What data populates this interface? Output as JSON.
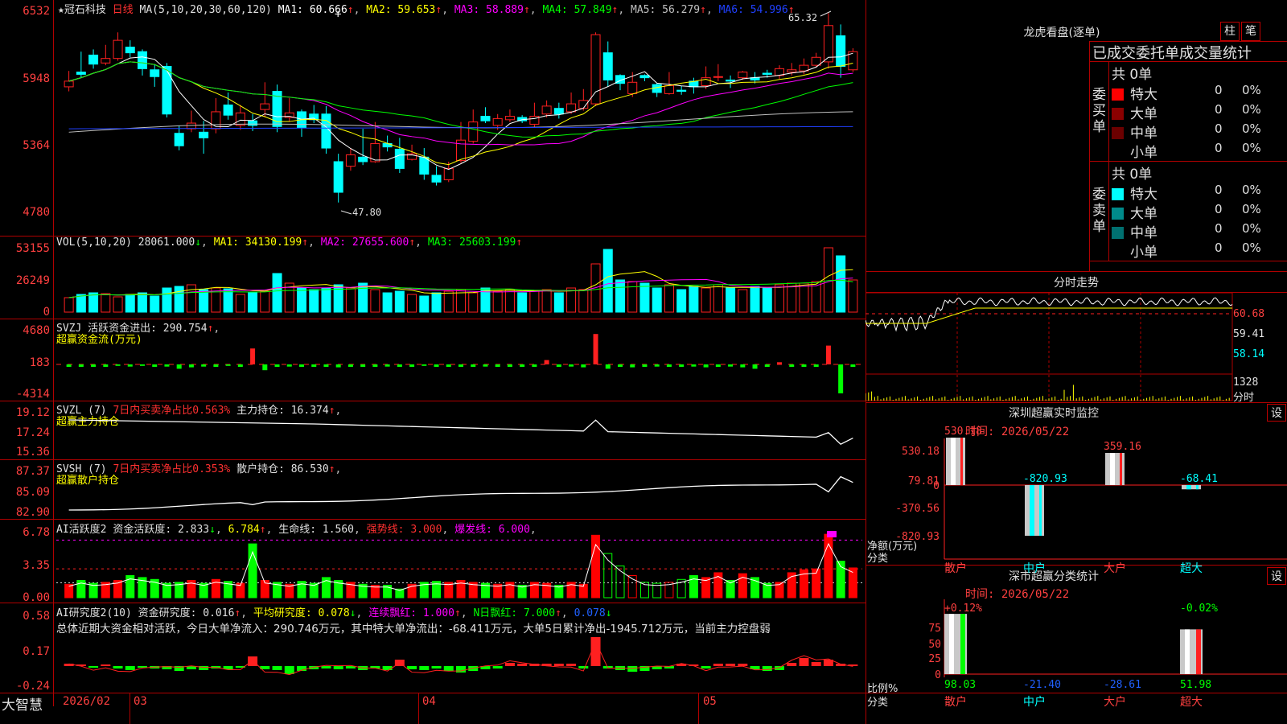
{
  "chart": {
    "stock_name": "★冠石科技",
    "period": "日线",
    "ma_label": "MA(5,10,20,30,60,120)",
    "ma_values": [
      {
        "text": "MA1: 60.666",
        "color": "#ffffff"
      },
      {
        "text": "MA2: 59.653",
        "color": "#ffff00"
      },
      {
        "text": "MA3: 58.889",
        "color": "#ff00ff"
      },
      {
        "text": "MA4: 57.849",
        "color": "#00ff00"
      },
      {
        "text": "MA5: 56.279",
        "color": "#c0c0c0"
      },
      {
        "text": "MA6: 54.996",
        "color": "#2040ff"
      }
    ],
    "price_ticks": [
      "6532",
      "5948",
      "5364",
      "4780"
    ],
    "max_label": "65.32",
    "min_label": "47.80",
    "vol_header": {
      "name": "VOL(5,10,20)",
      "value": "28061.000",
      "ma1": "MA1: 34130.199",
      "ma2": "MA2: 27655.600",
      "ma3": "MA3: 25603.199"
    },
    "vol_ticks": [
      "53155",
      "26249",
      "0"
    ],
    "svzj_header": {
      "name": "SVZJ",
      "text": "活跃资金进出: 290.754",
      "sub": "超赢资金流(万元)"
    },
    "svzj_ticks": [
      "4680",
      "183",
      "-4314"
    ],
    "svzl_header": {
      "name": "SVZL (7)",
      "ratio": "7日内买卖净占比0.563%",
      "text": "主力持仓: 16.374",
      "sub": "超赢主力持仓"
    },
    "svzl_ticks": [
      "19.12",
      "17.24",
      "15.36"
    ],
    "svsh_header": {
      "name": "SVSH (7)",
      "ratio": "7日内买卖净占比0.353%",
      "text": "散户持仓: 86.530",
      "sub": "超赢散户持仓"
    },
    "svsh_ticks": [
      "87.37",
      "85.09",
      "82.90"
    ],
    "ai_act_header": {
      "name": "AI活跃度2",
      "text": "资金活跃度: 2.833",
      "v2": "6.784",
      "life": "生命线: 1.560",
      "strong": "强势线: 3.000",
      "burst": "爆发线: 6.000"
    },
    "ai_act_ticks": [
      "6.78",
      "3.35",
      "0.00"
    ],
    "ai_res_header": {
      "name": "AI研究度2(10)",
      "text": "资金研究度: 0.016",
      "avg": "平均研究度: 0.078",
      "cont": "连续飘红: 1.000",
      "nday": "N日飘红: 7.000",
      "last": "0.078"
    },
    "ai_res_ticks": [
      "0.58",
      "0.17",
      "-0.24"
    ],
    "summary": "总体近期大资金相对活跃，今日大单净流入：290.746万元，其中特大单净流出：-68.411万元，大单5日累计净出-1945.712万元，当前主力控盘弱",
    "footer": {
      "brand": "大智慧",
      "dates": [
        "2026/02",
        "03",
        "04",
        "05"
      ]
    }
  },
  "chart_data": [
    {
      "type": "bar",
      "title": "深圳超赢实时监控",
      "subtitle": "时间: 2026/05/22",
      "categories": [
        "散户",
        "中户",
        "大户",
        "超大"
      ],
      "values": [
        530.18,
        -820.93,
        359.16,
        -68.41
      ],
      "ylim": [
        -820.93,
        530.18
      ],
      "yticks": [
        "530.18",
        "79.81",
        "0",
        "-370.56",
        "-820.93"
      ],
      "ylabel": "净额(万元)",
      "xlabel": "分类"
    },
    {
      "type": "bar",
      "title": "深市超赢分类统计",
      "subtitle": "时间: 2026/05/22",
      "categories": [
        "散户",
        "中户",
        "大户",
        "超大"
      ],
      "values": [
        98.03,
        -21.4,
        -28.61,
        51.98
      ],
      "labels_top": [
        "+0.12%",
        "",
        "",
        "-0.02%"
      ],
      "yticks": [
        "75",
        "50",
        "25",
        "0"
      ],
      "ylabel": "比例%",
      "xlabel": "分类"
    }
  ],
  "dragon": {
    "title": "龙虎看盘(逐单)",
    "btn_zhu": "柱",
    "btn_bi": "笔",
    "subtitle": "已成交委托单成交量统计",
    "buy_label": "委买单",
    "sell_label": "委卖单",
    "buy_total": "共 0单",
    "sell_total": "共 0单",
    "rows": [
      "特大",
      "大单",
      "中单",
      "小单"
    ],
    "buy_colors": [
      "#ff0000",
      "#8b0000",
      "#6b0000",
      "#000000"
    ],
    "sell_colors": [
      "#00ffff",
      "#008b8b",
      "#007070",
      "#000000"
    ],
    "val": "0",
    "pct": "0%"
  },
  "intraday": {
    "title": "分时走势",
    "ticks": [
      "60.68",
      "59.41",
      "58.14"
    ],
    "vol_tick": "1328",
    "vol_unit": "分时"
  },
  "monitor": {
    "btn": "设"
  },
  "classify": {
    "btn": "设"
  }
}
